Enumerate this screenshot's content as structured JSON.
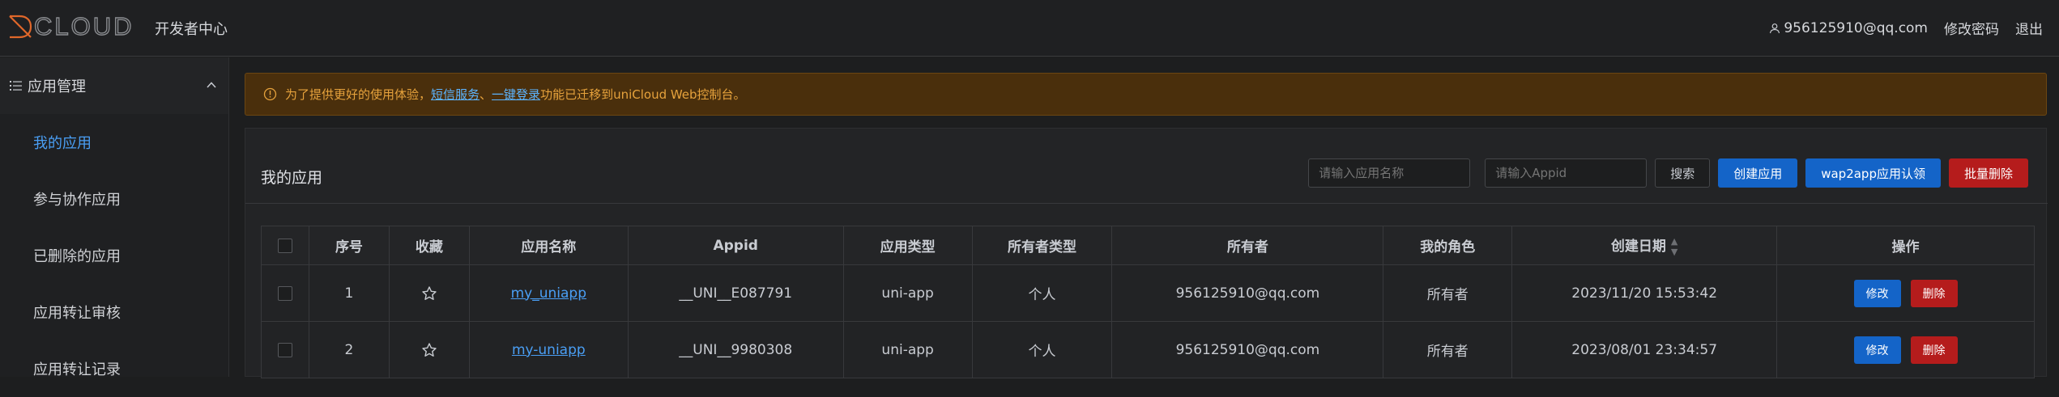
{
  "header": {
    "logo_text": "DCLOUD",
    "subtitle": "开发者中心",
    "user_email": "956125910@qq.com",
    "change_password": "修改密码",
    "logout": "退出"
  },
  "sidebar": {
    "section_label": "应用管理",
    "items": [
      {
        "label": "我的应用",
        "active": true
      },
      {
        "label": "参与协作应用",
        "active": false
      },
      {
        "label": "已删除的应用",
        "active": false
      },
      {
        "label": "应用转让审核",
        "active": false
      },
      {
        "label": "应用转让记录",
        "active": false
      }
    ]
  },
  "notice": {
    "prefix": "为了提供更好的使用体验，",
    "link1": "短信服务",
    "sep": "、",
    "link2": "一键登录",
    "suffix": "功能已迁移到uniCloud Web控制台。"
  },
  "card": {
    "title": "我的应用",
    "search_name_placeholder": "请输入应用名称",
    "search_appid_placeholder": "请输入Appid",
    "search_button": "搜索",
    "create_button": "创建应用",
    "wap2app_button": "wap2app应用认领",
    "batch_delete_button": "批量删除"
  },
  "table": {
    "columns": [
      "序号",
      "收藏",
      "应用名称",
      "Appid",
      "应用类型",
      "所有者类型",
      "所有者",
      "我的角色",
      "创建日期",
      "操作"
    ],
    "rows": [
      {
        "index": "1",
        "name": "my_uniapp",
        "appid": "__UNI__E087791",
        "type": "uni-app",
        "owner_type": "个人",
        "owner": "956125910@qq.com",
        "role": "所有者",
        "created": "2023/11/20 15:53:42",
        "edit": "修改",
        "delete": "删除"
      },
      {
        "index": "2",
        "name": "my-uniapp",
        "appid": "__UNI__9980308",
        "type": "uni-app",
        "owner_type": "个人",
        "owner": "956125910@qq.com",
        "role": "所有者",
        "created": "2023/08/01 23:34:57",
        "edit": "修改",
        "delete": "删除"
      }
    ]
  },
  "colors": {
    "accent": "#4a9ff5",
    "primary_button": "#1464c8",
    "danger_button": "#b51c1c",
    "notice_bg": "#4a2f0c",
    "notice_text": "#e6a23c"
  },
  "icons": {
    "logo": "dcloud-logo-icon",
    "user": "user-icon",
    "menu": "menu-list-icon",
    "collapse": "chevron-up-icon",
    "notice": "info-circle-icon",
    "favorite": "star-outline-icon",
    "sort": "sort-caret-icon"
  }
}
